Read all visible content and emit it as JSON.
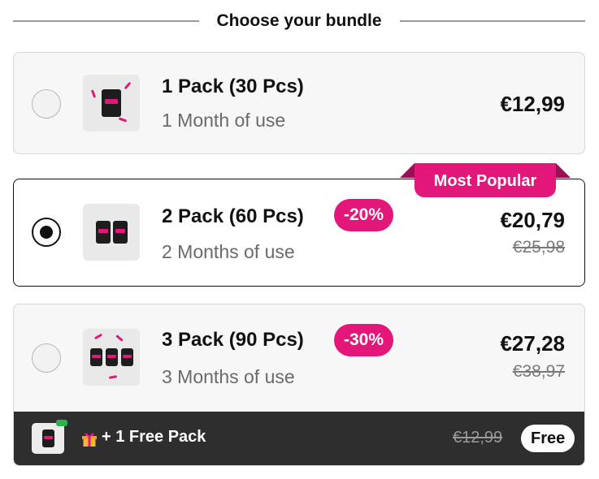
{
  "heading": "Choose your bundle",
  "colors": {
    "accent": "#e3177a",
    "dark_bar": "#2e2e2e",
    "muted_text": "#6a6a6a"
  },
  "bundles": [
    {
      "title": "1 Pack (30 Pcs)",
      "subtitle": "1 Month of use",
      "price": "€12,99",
      "selected": false
    },
    {
      "title": "2 Pack (60 Pcs)",
      "subtitle": "2 Months of use",
      "discount": "-20%",
      "price": "€20,79",
      "old_price": "€25,98",
      "badge": "Most Popular",
      "selected": true
    },
    {
      "title": "3 Pack (90 Pcs)",
      "subtitle": "3 Months of use",
      "discount": "-30%",
      "price": "€27,28",
      "old_price": "€38,97",
      "selected": false,
      "bonus": {
        "icon": "gift-icon",
        "label": "+ 1 Free Pack",
        "old_price": "€12,99",
        "price_label": "Free"
      }
    }
  ]
}
